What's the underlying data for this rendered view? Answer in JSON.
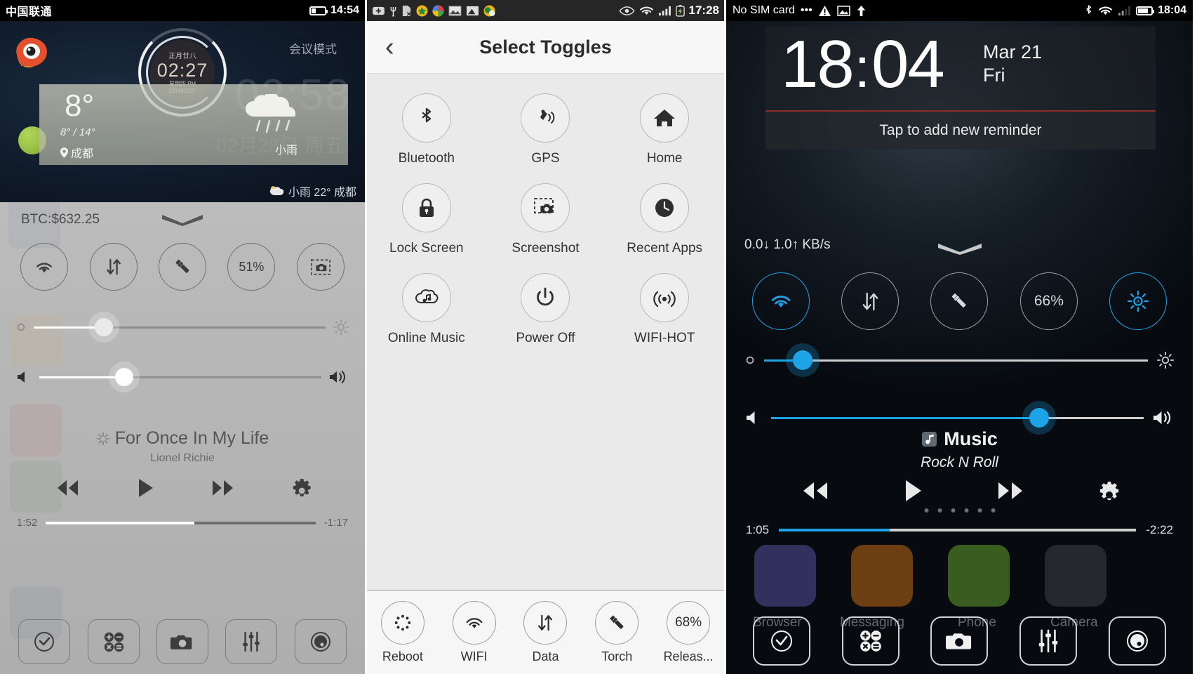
{
  "panel1": {
    "status": {
      "carrier": "中国联通",
      "time": "14:54",
      "battery_icon": "battery-icon"
    },
    "lockscreen": {
      "clock_lunar": "正月廿八",
      "clock_time": "02:27",
      "clock_weekday": "星期四 PM",
      "clock_date": "2014/02/27",
      "mode_label": "会议模式",
      "ghost_time": "02:58",
      "ghost_date": "02月28日 周五",
      "weather": {
        "temp": "8°",
        "range": "8° / 14°",
        "city": "成都",
        "condition": "小雨"
      },
      "weather_bar": "小雨 22° 成都"
    },
    "drawer": {
      "ticker": "BTC:$632.25",
      "toggles": [
        {
          "name": "wifi",
          "label": ""
        },
        {
          "name": "data",
          "label": ""
        },
        {
          "name": "torch",
          "label": ""
        },
        {
          "name": "battery",
          "label": "51%"
        },
        {
          "name": "screenshot",
          "label": ""
        }
      ],
      "brightness_percent": 24,
      "volume_percent": 30,
      "music": {
        "title": "For Once In My Life",
        "artist": "Lionel Richie",
        "elapsed": "1:52",
        "remaining": "-1:17",
        "progress_percent": 55
      },
      "dock": [
        "check-circle",
        "calculator",
        "camera",
        "equalizer",
        "record"
      ]
    }
  },
  "panel2": {
    "status": {
      "time": "17:28",
      "icons": [
        "add-icon",
        "usb-icon",
        "sim-error-icon",
        "app-icon-1",
        "app-icon-2",
        "gallery-icon",
        "file-icon",
        "app-icon-3",
        "eye-icon",
        "wifi-icon",
        "signal-icon",
        "charging-icon"
      ]
    },
    "header": {
      "back": "‹",
      "title": "Select Toggles"
    },
    "grid": [
      {
        "label": "Bluetooth",
        "icon": "bluetooth-icon"
      },
      {
        "label": "GPS",
        "icon": "gps-icon"
      },
      {
        "label": "Home",
        "icon": "home-icon"
      },
      {
        "label": "Lock Screen",
        "icon": "lock-icon"
      },
      {
        "label": "Screenshot",
        "icon": "screenshot-icon"
      },
      {
        "label": "Recent Apps",
        "icon": "recent-apps-icon"
      },
      {
        "label": "Online Music",
        "icon": "online-music-icon"
      },
      {
        "label": "Power Off",
        "icon": "power-icon"
      },
      {
        "label": "WIFI-HOT",
        "icon": "wifi-hotspot-icon"
      }
    ],
    "bottom": [
      {
        "label": "Reboot",
        "icon": "reboot-icon",
        "value": ""
      },
      {
        "label": "WIFI",
        "icon": "wifi-icon",
        "value": ""
      },
      {
        "label": "Data",
        "icon": "data-icon",
        "value": ""
      },
      {
        "label": "Torch",
        "icon": "torch-icon",
        "value": ""
      },
      {
        "label": "Releas...",
        "icon": "battery-icon",
        "value": "68%"
      }
    ]
  },
  "panel3": {
    "status": {
      "carrier": "No SIM card",
      "time": "18:04"
    },
    "lockscreen": {
      "hours": "18",
      "colon": ":",
      "minutes": "04",
      "date": "Mar 21",
      "weekday": "Fri",
      "reminder": "Tap to add new reminder"
    },
    "drawer": {
      "net_speed": "0.0↓ 1.0↑ KB/s",
      "toggles": [
        {
          "name": "wifi",
          "label": "",
          "active": true
        },
        {
          "name": "data",
          "label": "",
          "active": false
        },
        {
          "name": "torch",
          "label": "",
          "active": false
        },
        {
          "name": "battery",
          "label": "66%",
          "active": false
        },
        {
          "name": "brightness",
          "label": "",
          "active": true
        }
      ],
      "brightness_percent": 10,
      "volume_percent": 72,
      "music": {
        "app": "Music",
        "title": "Rock N Roll",
        "elapsed": "1:05",
        "remaining": "-2:22",
        "progress_percent": 31
      },
      "dock": [
        "check-circle",
        "calculator",
        "camera",
        "equalizer",
        "record"
      ],
      "home_apps": [
        "Browser",
        "Messaging",
        "Phone",
        "Camera"
      ]
    }
  },
  "colors": {
    "accent_blue": "#1ca3e8",
    "panel1_bg": "#b7b7b7",
    "panel2_bg": "#eaeaea",
    "panel3_bg": "#05080c",
    "reminder_divider": "#8d2a2a"
  }
}
